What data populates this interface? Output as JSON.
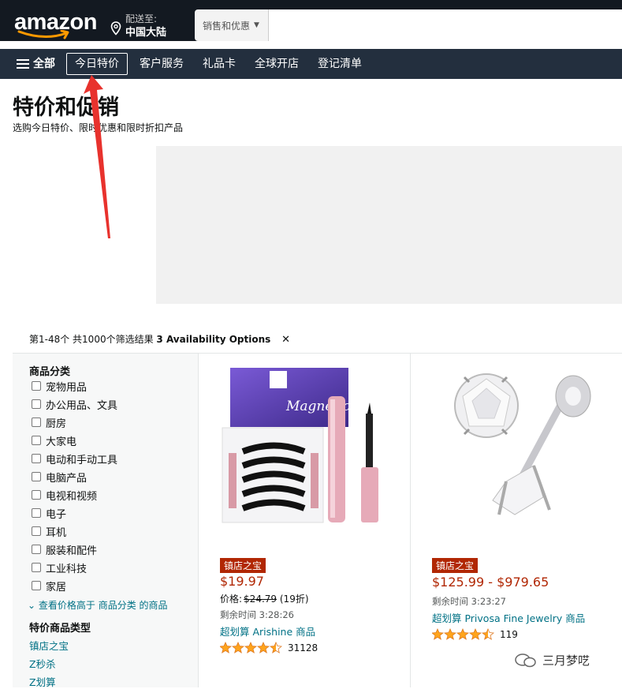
{
  "header": {
    "logo_text": "amazon",
    "deliver_line1": "配送至:",
    "deliver_line2": "中国大陆",
    "search_dept": "销售和优惠",
    "search_placeholder": ""
  },
  "nav": {
    "all_label": "全部",
    "items": [
      "今日特价",
      "客户服务",
      "礼品卡",
      "全球开店",
      "登记清单"
    ],
    "active_index": 0
  },
  "page": {
    "title": "特价和促销",
    "subtitle": "选购今日特价、限时优惠和限时折扣产品"
  },
  "results": {
    "text": "第1-48个 共1000个筛选结果",
    "filter": "3 Availability Options",
    "clear_symbol": "✕"
  },
  "sidebar": {
    "category_heading": "商品分类",
    "categories": [
      "宠物用品",
      "办公用品、文具",
      "厨房",
      "大家电",
      "电动和手动工具",
      "电脑产品",
      "电视和视频",
      "电子",
      "耳机",
      "服装和配件",
      "工业科技",
      "家居"
    ],
    "more_link": "查看价格高于 商品分类 的商品",
    "type_heading": "特价商品类型",
    "types": [
      "镇店之宝",
      "Z秒杀",
      "Z划算"
    ]
  },
  "products": [
    {
      "badge": "镇店之宝",
      "price": "$19.97",
      "list_price_label": "价格:",
      "list_price": "$24.79",
      "discount": "(19折)",
      "timer": "剩余时间 3:28:26",
      "store": "超划算 Arishine 商品",
      "rating": 4.5,
      "review_count": "31128",
      "image": "magnetic-eyelashes-kit"
    },
    {
      "badge": "镇店之宝",
      "price": "$125.99 - $979.65",
      "timer": "剩余时间 3:23:27",
      "store": "超划算 Privosa Fine Jewelry 商品",
      "rating": 4.5,
      "review_count": "119",
      "image": "diamond-stud-earring"
    }
  ],
  "watermark": {
    "text": "三月梦呓"
  },
  "colors": {
    "nav_top": "#131921",
    "nav_main": "#232f3e",
    "price_red": "#b12704",
    "link_teal": "#007185",
    "star": "#ffa41c",
    "annotation_arrow": "#e8322d"
  }
}
